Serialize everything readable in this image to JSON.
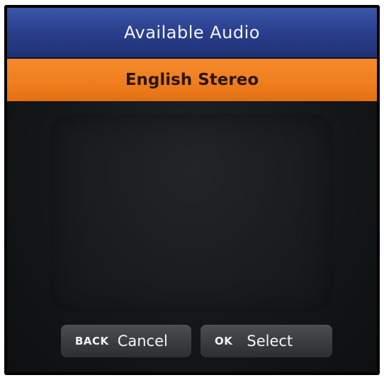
{
  "header": {
    "title": "Available Audio"
  },
  "audio_list": {
    "items": [
      {
        "label": "English Stereo",
        "selected": true
      }
    ]
  },
  "footer": {
    "back_button": {
      "key": "BACK",
      "label": "Cancel"
    },
    "ok_button": {
      "key": "OK",
      "label": "Select"
    }
  },
  "colors": {
    "header_blue": "#2a3f8c",
    "selection_orange": "#ef7d1d",
    "button_gray": "#3a3d3f"
  }
}
